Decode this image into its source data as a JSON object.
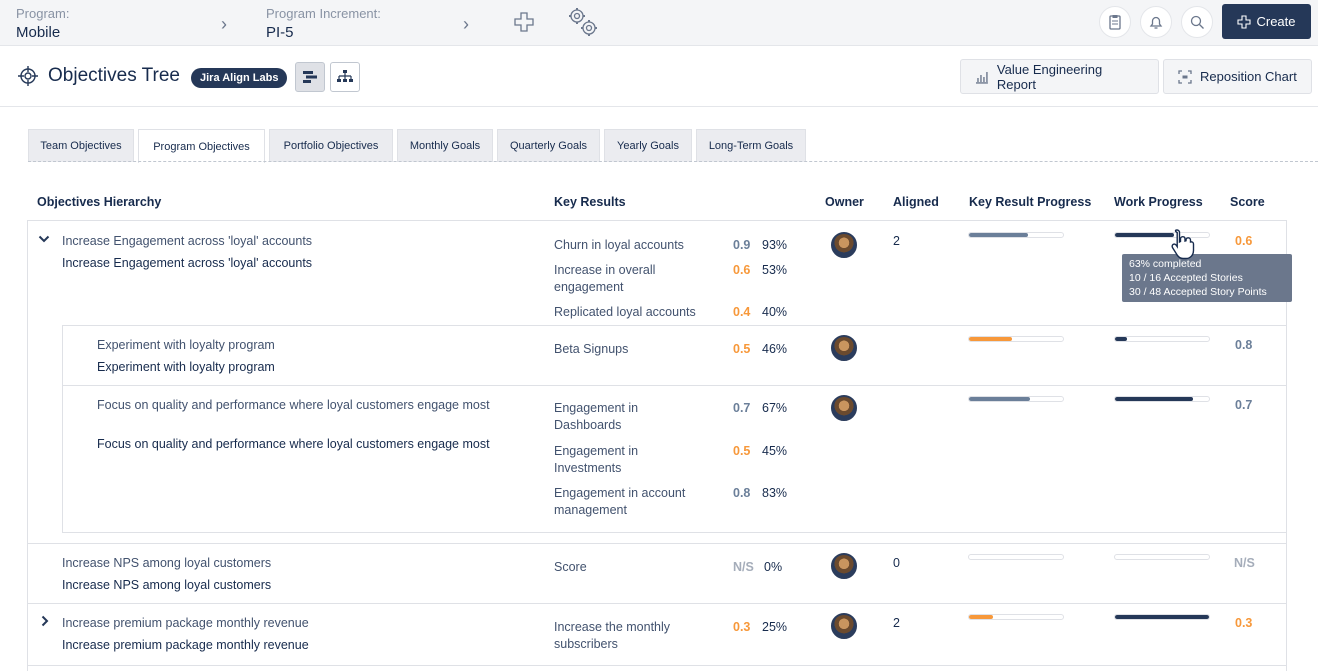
{
  "topbar": {
    "program_label": "Program:",
    "program_value": "Mobile",
    "pi_label": "Program Increment:",
    "pi_value": "PI-5",
    "create_label": "Create",
    "icons": [
      "chevron-right-icon",
      "plus-icon",
      "gears-icon",
      "clipboard-icon",
      "bell-icon",
      "search-icon"
    ]
  },
  "header": {
    "title": "Objectives Tree",
    "badge": "Jira Align Labs",
    "value_engineering_label": "Value Engineering Report",
    "reposition_label": "Reposition Chart"
  },
  "tabs": [
    "Team Objectives",
    "Program Objectives",
    "Portfolio Objectives",
    "Monthly Goals",
    "Quarterly Goals",
    "Yearly Goals",
    "Long-Term Goals"
  ],
  "active_tab": "Program Objectives",
  "columns": {
    "hierarchy": "Objectives Hierarchy",
    "key_results": "Key Results",
    "owner": "Owner",
    "aligned": "Aligned",
    "kr_progress": "Key Result Progress",
    "work_progress": "Work Progress",
    "score": "Score"
  },
  "rows": [
    {
      "link": "Increase Engagement across 'loyal' accounts",
      "name": "Increase Engagement across 'loyal' accounts",
      "aligned": "2",
      "score": "0.6",
      "kr_progress": 0.63,
      "work_progress": 0.63,
      "key_results": [
        {
          "label": "Churn in loyal accounts",
          "score": "0.9",
          "pct": "93%"
        },
        {
          "label": "Increase in overall engagement",
          "score": "0.6",
          "pct": "53%"
        },
        {
          "label": "Replicated loyal accounts",
          "score": "0.4",
          "pct": "40%"
        }
      ]
    },
    {
      "link": "Experiment with loyalty program",
      "name": "Experiment with loyalty program",
      "aligned": "",
      "score": "0.8",
      "kr_progress": 0.46,
      "work_progress": 0.13,
      "key_results": [
        {
          "label": "Beta Signups",
          "score": "0.5",
          "pct": "46%"
        }
      ]
    },
    {
      "link": "Focus on quality and performance where loyal customers engage most",
      "name": "Focus on quality and performance where loyal customers engage most",
      "aligned": "",
      "score": "0.7",
      "kr_progress": 0.65,
      "work_progress": 0.83,
      "key_results": [
        {
          "label": "Engagement in Dashboards",
          "score": "0.7",
          "pct": "67%"
        },
        {
          "label": "Engagement in Investments",
          "score": "0.5",
          "pct": "45%"
        },
        {
          "label": "Engagement in account management",
          "score": "0.8",
          "pct": "83%"
        }
      ]
    },
    {
      "link": "Increase NPS among loyal customers",
      "name": "Increase NPS among loyal customers",
      "aligned": "0",
      "score": "N/S",
      "kr_progress": 0,
      "work_progress": 0,
      "key_results": [
        {
          "label": "Score",
          "score": "N/S",
          "pct": "0%"
        }
      ]
    },
    {
      "link": "Increase premium package monthly revenue",
      "name": "Increase premium package monthly revenue",
      "aligned": "2",
      "score": "0.3",
      "kr_progress": 0.25,
      "work_progress": 1.0,
      "key_results": [
        {
          "label": "Increase the monthly subscribers",
          "score": "0.3",
          "pct": "25%"
        }
      ]
    }
  ],
  "tooltip": {
    "line1": "63% completed",
    "line2": "10 / 16 Accepted Stories",
    "line3": "30 / 48 Accepted Story Points"
  },
  "colors": {
    "navy": "#253858",
    "orange": "#f7983a",
    "slate": "#6b7f99"
  }
}
